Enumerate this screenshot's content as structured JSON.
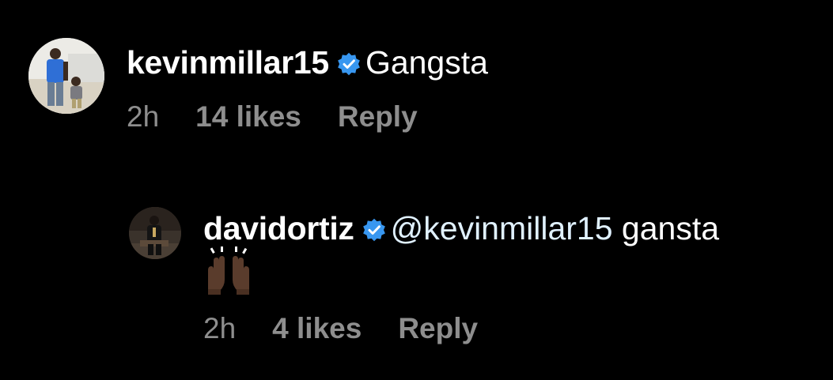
{
  "colors": {
    "background": "#000000",
    "text": "#ffffff",
    "meta": "#8e8e8e",
    "verified_badge": "#3897f0",
    "mention": "#e0f1ff"
  },
  "comments": [
    {
      "username": "kevinmillar15",
      "verified_icon": "verified-badge-icon",
      "text": "Gangsta",
      "time": "2h",
      "likes": "14 likes",
      "reply_label": "Reply"
    },
    {
      "username": "davidortiz",
      "verified_icon": "verified-badge-icon",
      "mention": "@kevinmillar15",
      "text": " gansta",
      "emoji_icon": "raising-hands-emoji-icon",
      "time": "2h",
      "likes": "4 likes",
      "reply_label": "Reply"
    }
  ]
}
